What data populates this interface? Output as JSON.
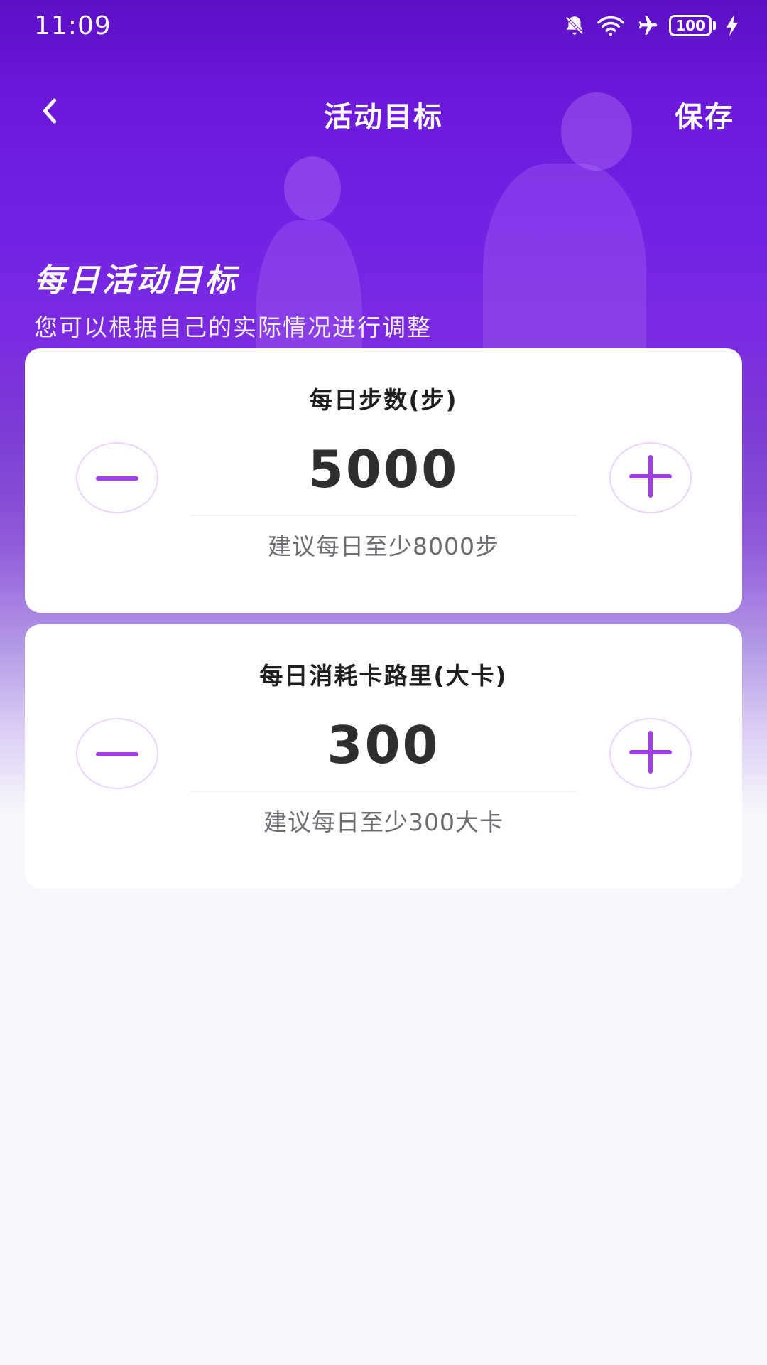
{
  "status_bar": {
    "time": "11:09",
    "battery": "100",
    "icons": [
      "bell-muted-icon",
      "wifi-icon",
      "airplane-icon",
      "battery-icon",
      "charging-icon"
    ]
  },
  "nav": {
    "back_icon": "chevron-left-icon",
    "title": "活动目标",
    "save_label": "保存"
  },
  "hero": {
    "heading": "每日活动目标",
    "subheading": "您可以根据自己的实际情况进行调整"
  },
  "goals": [
    {
      "title": "每日步数(步)",
      "value": "5000",
      "hint": "建议每日至少8000步",
      "decrement_icon": "minus-icon",
      "increment_icon": "plus-icon"
    },
    {
      "title": "每日消耗卡路里(大卡)",
      "value": "300",
      "hint": "建议每日至少300大卡",
      "decrement_icon": "minus-icon",
      "increment_icon": "plus-icon"
    }
  ],
  "colors": {
    "primary_purple": "#6a18d8",
    "stepper_accent": "#a23ee8",
    "page_background": "#f6f6fb"
  }
}
